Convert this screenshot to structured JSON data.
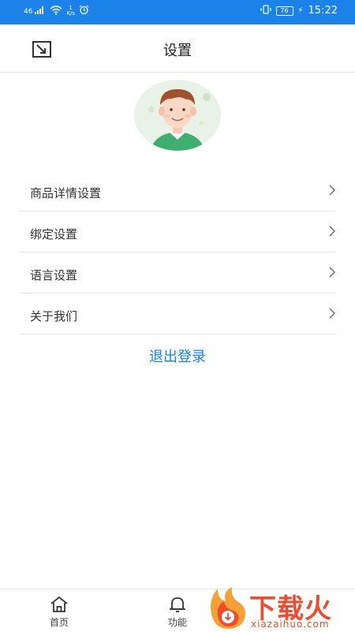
{
  "status_bar": {
    "signal": "46",
    "net_speed_top": "1",
    "net_speed_unit": "K/s",
    "battery": "76",
    "time": "15:22"
  },
  "header": {
    "title": "设置"
  },
  "menu": [
    {
      "label": "商品详情设置"
    },
    {
      "label": "绑定设置"
    },
    {
      "label": "语言设置"
    },
    {
      "label": "关于我们"
    }
  ],
  "logout_label": "退出登录",
  "tabbar": {
    "items": [
      {
        "label": "首页",
        "icon": "home-icon"
      },
      {
        "label": "功能",
        "icon": "bell-icon"
      }
    ]
  },
  "watermark": {
    "text": "下载火",
    "sub": "xiazaihuo.com"
  },
  "colors": {
    "accent": "#1a82e8",
    "watermark": "#f04b2c"
  }
}
